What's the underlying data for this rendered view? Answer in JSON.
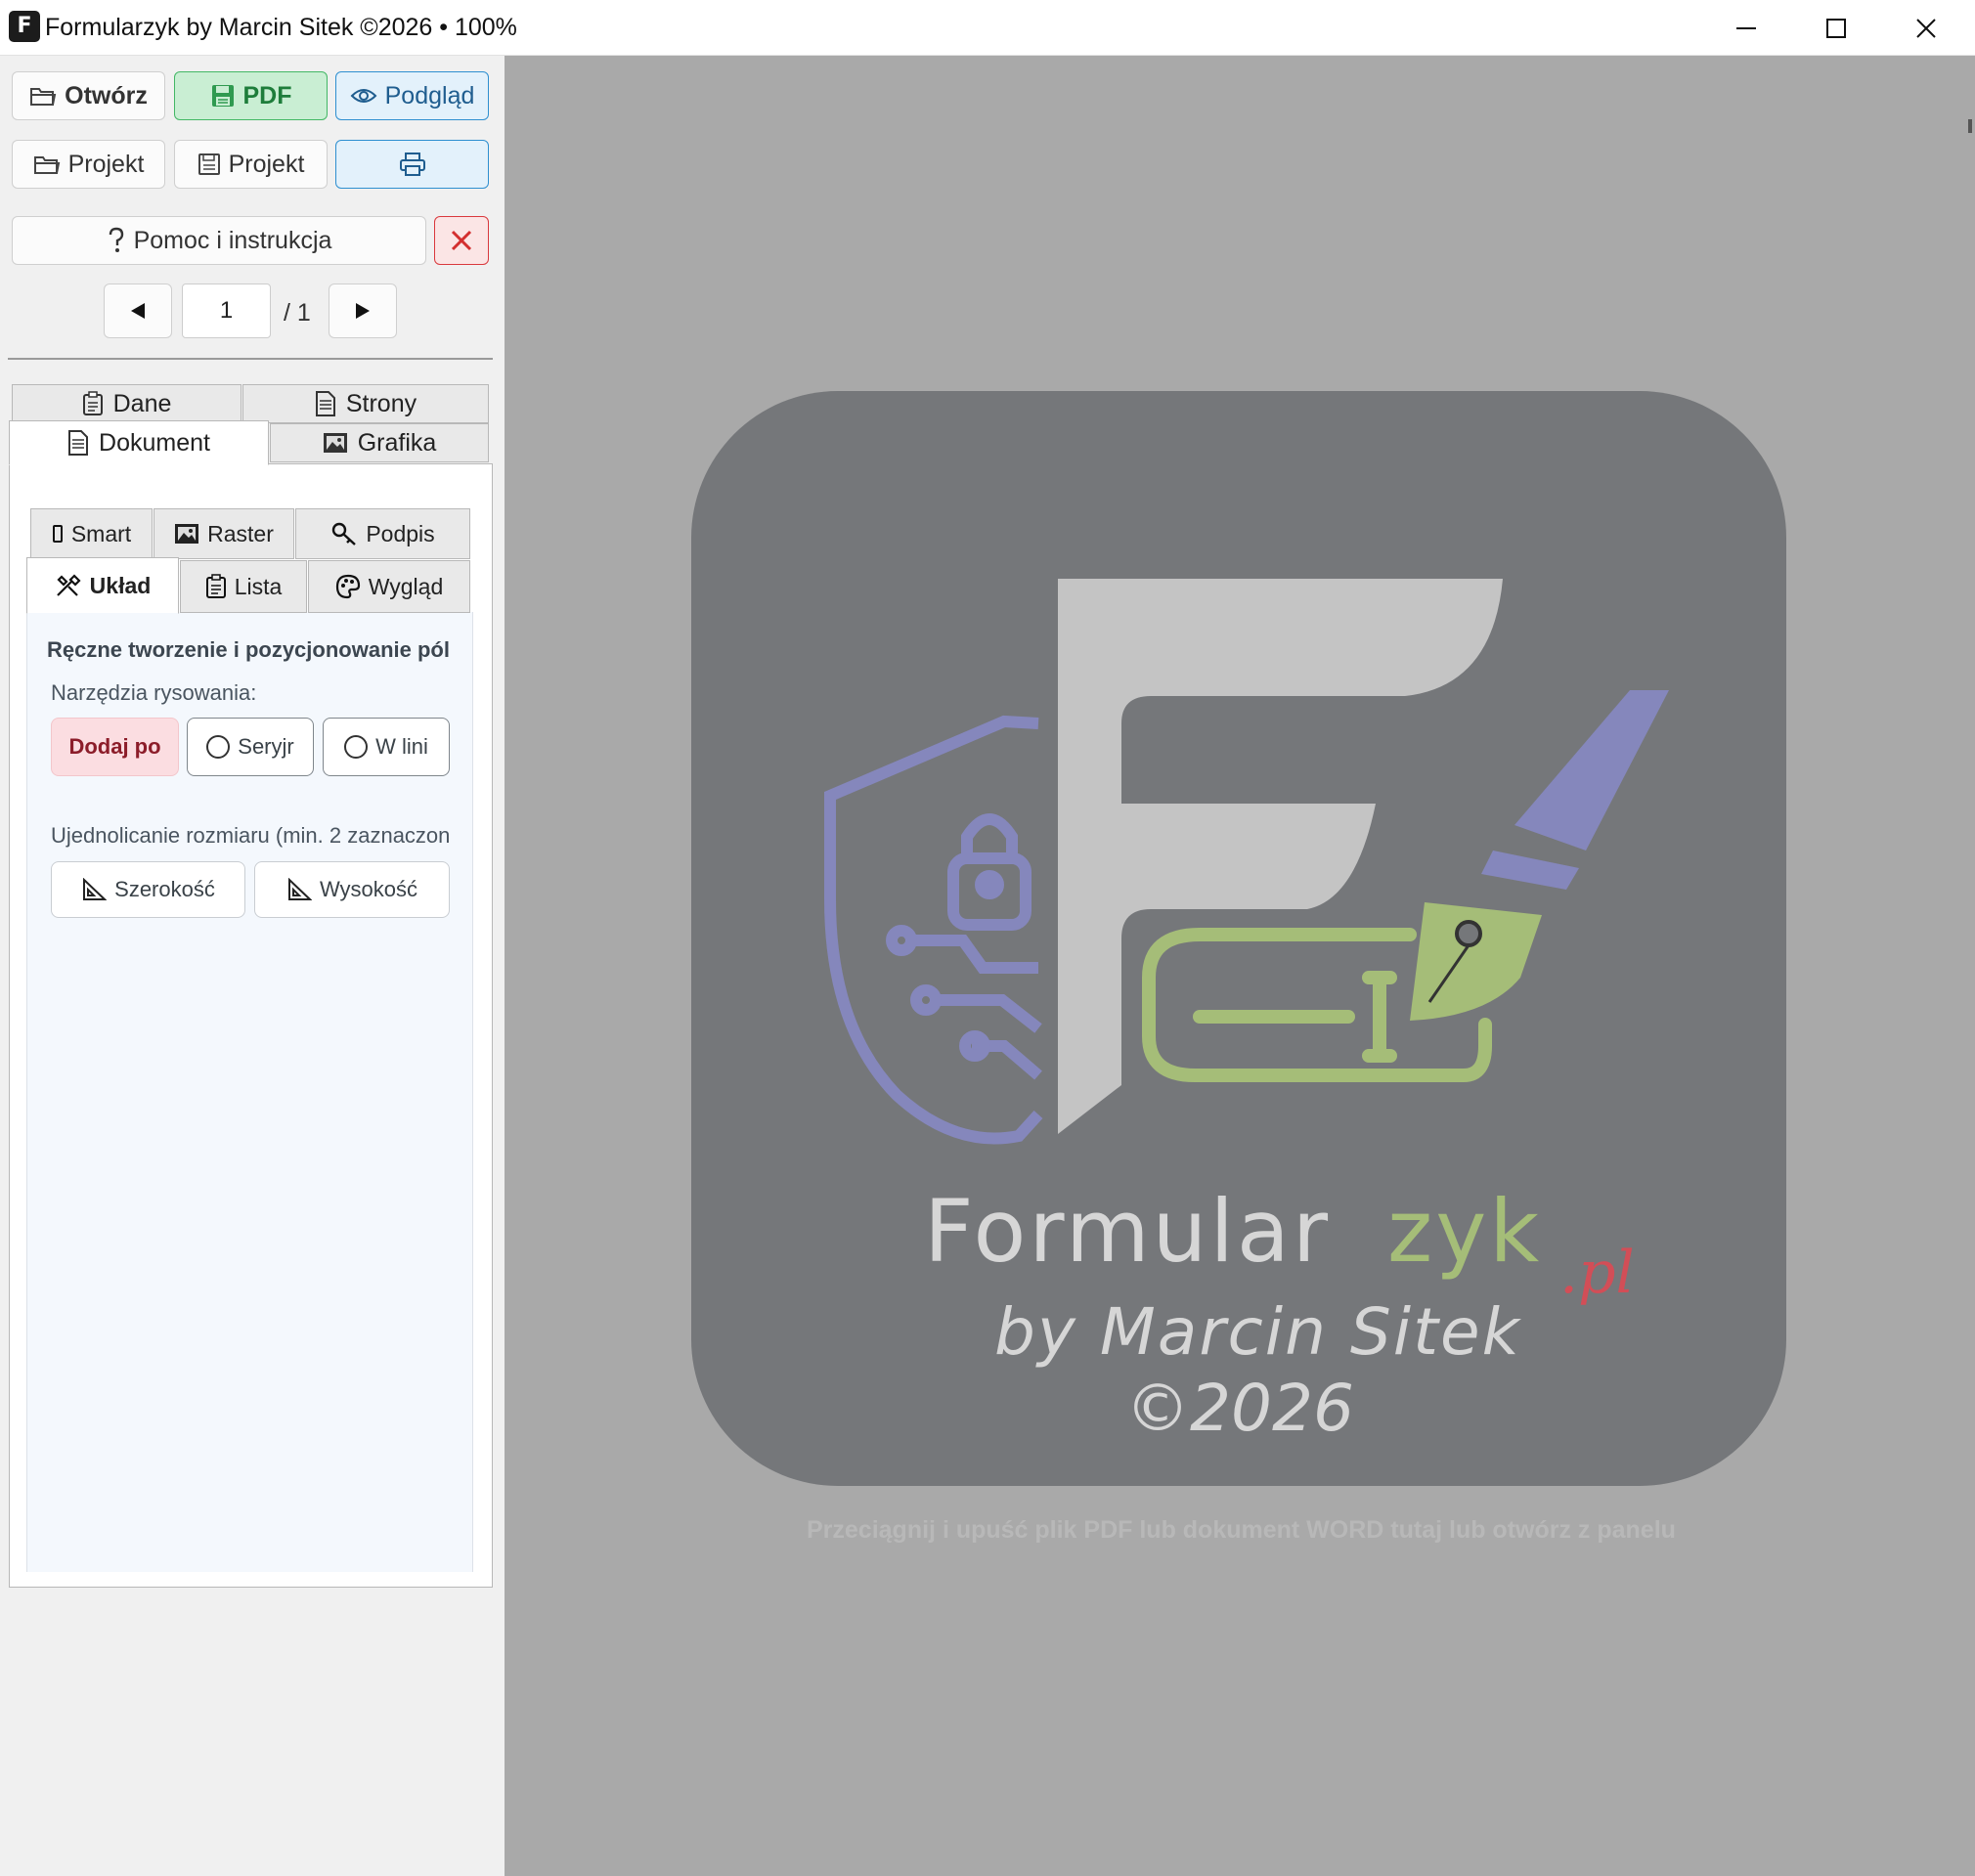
{
  "window": {
    "title": "Formularzyk by Marcin Sitek ©2026 • 100%",
    "app_icon_letter": "F",
    "minimize_icon": "minimize-icon",
    "maximize_icon": "maximize-icon",
    "close_icon": "close-icon"
  },
  "toolbar": {
    "open_label": "Otwórz",
    "pdf_label": "PDF",
    "preview_label": "Podgląd",
    "open_project_label": "Projekt",
    "save_project_label": "Projekt",
    "print_icon": "printer-icon",
    "help_label": "Pomoc i instrukcja",
    "close_icon": "close-icon"
  },
  "paging": {
    "current_page": "1",
    "total_label": "/ 1"
  },
  "tabs": {
    "row1": [
      "Dane",
      "Strony"
    ],
    "row2": [
      "Dokument",
      "Grafika"
    ],
    "active": "Dokument"
  },
  "subtabs": {
    "row1": [
      "Smart",
      "Raster",
      "Podpis"
    ],
    "row2": [
      "Układ",
      "Lista",
      "Wygląd"
    ],
    "active": "Układ"
  },
  "layout_panel": {
    "title": "Ręczne tworzenie i pozycjonowanie pól",
    "tools_label": "Narzędzia rysowania:",
    "tools": [
      "Dodaj po",
      "Seryjr",
      "W lini"
    ],
    "active_tool": "Dodaj po",
    "size_label": "Ujednolicanie rozmiaru (min. 2 zaznaczon",
    "width_button": "Szerokość",
    "height_button": "Wysokość"
  },
  "canvas": {
    "logo_word_a": "Formular",
    "logo_word_b": "zyk",
    "logo_suffix": ".pl",
    "logo_byline": "by Marcin Sitek",
    "logo_year": "©2026",
    "hint": "Przeciągnij i upuść plik PDF lub dokument WORD tutaj lub otwórz z panelu"
  },
  "colors": {
    "accent_green": "#43b765",
    "accent_blue": "#2e8fd0",
    "accent_red": "#d9393d",
    "canvas_bg": "#a9a9a9",
    "logo_tile": "#75777a",
    "logo_purple": "#8587bc",
    "logo_olive": "#a5bd78",
    "logo_light": "#c4c4c4",
    "logo_red": "#d24e57"
  }
}
